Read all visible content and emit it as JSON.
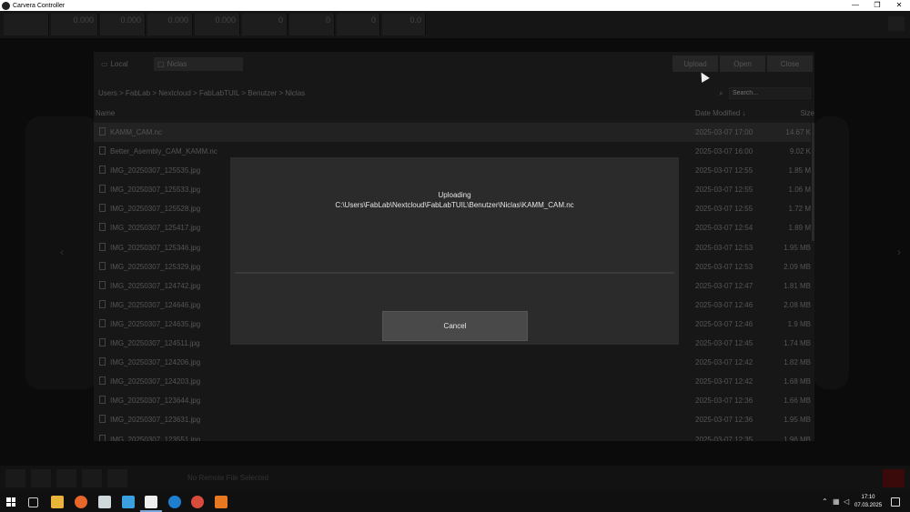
{
  "window": {
    "title": "Carvera Controller",
    "minimize_glyph": "—",
    "restore_glyph": "❐",
    "close_glyph": "✕"
  },
  "toolbar": {
    "values": [
      "0.000",
      "0.000",
      "0.000",
      "0.000"
    ],
    "small_values": [
      "0",
      "0",
      "0",
      "0.0"
    ]
  },
  "file_dialog": {
    "tabs": [
      {
        "label": "Local",
        "icon": "computer-icon"
      },
      {
        "label": "Niclas",
        "icon": "folder-icon"
      }
    ],
    "buttons": {
      "upload": "Upload",
      "open": "Open",
      "close": "Close"
    },
    "breadcrumb": "Users > FabLab > Nextcloud > FabLabTUIL > Benutzer > Niclas",
    "search_placeholder": "Search...",
    "columns": {
      "name": "Name",
      "date_modified": "Date Modified ↓",
      "size": "Size"
    },
    "files": [
      {
        "name": "KAMM_CAM.nc",
        "date": "2025-03-07 17:00",
        "size": "14.67 K"
      },
      {
        "name": "Better_Asembly_CAM_KAMM.nc",
        "date": "2025-03-07 16:00",
        "size": "9.02 K"
      },
      {
        "name": "IMG_20250307_125535.jpg",
        "date": "2025-03-07 12:55",
        "size": "1.85 M"
      },
      {
        "name": "IMG_20250307_125533.jpg",
        "date": "2025-03-07 12:55",
        "size": "1.06 M"
      },
      {
        "name": "IMG_20250307_125528.jpg",
        "date": "2025-03-07 12:55",
        "size": "1.72 M"
      },
      {
        "name": "IMG_20250307_125417.jpg",
        "date": "2025-03-07 12:54",
        "size": "1.89 M"
      },
      {
        "name": "IMG_20250307_125346.jpg",
        "date": "2025-03-07 12:53",
        "size": "1.95 MB"
      },
      {
        "name": "IMG_20250307_125329.jpg",
        "date": "2025-03-07 12:53",
        "size": "2.09 MB"
      },
      {
        "name": "IMG_20250307_124742.jpg",
        "date": "2025-03-07 12:47",
        "size": "1.81 MB"
      },
      {
        "name": "IMG_20250307_124646.jpg",
        "date": "2025-03-07 12:46",
        "size": "2.08 MB"
      },
      {
        "name": "IMG_20250307_124635.jpg",
        "date": "2025-03-07 12:46",
        "size": "1.9 MB"
      },
      {
        "name": "IMG_20250307_124511.jpg",
        "date": "2025-03-07 12:45",
        "size": "1.74 MB"
      },
      {
        "name": "IMG_20250307_124206.jpg",
        "date": "2025-03-07 12:42",
        "size": "1.82 MB"
      },
      {
        "name": "IMG_20250307_124203.jpg",
        "date": "2025-03-07 12:42",
        "size": "1.68 MB"
      },
      {
        "name": "IMG_20250307_123644.jpg",
        "date": "2025-03-07 12:36",
        "size": "1.66 MB"
      },
      {
        "name": "IMG_20250307_123631.jpg",
        "date": "2025-03-07 12:36",
        "size": "1.95 MB"
      },
      {
        "name": "IMG_20250307_123551.jpg",
        "date": "2025-03-07 12:35",
        "size": "1.96 MB"
      }
    ]
  },
  "upload_modal": {
    "title": "Uploading",
    "path": "C:\\Users\\FabLab\\Nextcloud\\FabLabTUIL\\Benutzer\\Niclas\\KAMM_CAM.nc",
    "progress": 0.0,
    "cancel_label": "Cancel"
  },
  "status_bar": {
    "text": "No Remote File Selected"
  },
  "taskbar": {
    "apps": [
      "start-icon",
      "task-view-icon",
      "file-explorer-icon",
      "firefox-icon",
      "notepad-icon",
      "finder-icon",
      "carvera-controller-icon",
      "nextcloud-icon",
      "chrome-icon",
      "fusion-icon"
    ],
    "clock_time": "17:10",
    "clock_date": "07.03.2025"
  }
}
